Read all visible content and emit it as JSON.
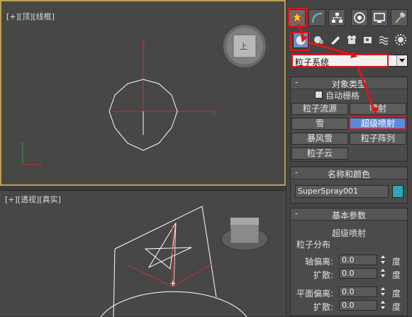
{
  "viewport_top": {
    "label": "[+][顶][线框]"
  },
  "viewport_persp": {
    "label": "[+][透视][真实]"
  },
  "viewcube": {
    "face_label": "上"
  },
  "panel": {
    "dropdown_value": "粒子系统",
    "object_type": {
      "title": "对象类型",
      "autogrid_label": "自动栅格",
      "buttons": [
        "粒子流源",
        "喷射",
        "雪",
        "超级喷射",
        "暴风雪",
        "粒子阵列",
        "粒子云"
      ],
      "selected": "超级喷射"
    },
    "name_color": {
      "title": "名称和颜色",
      "name_value": "SuperSpray001",
      "swatch_color": "#2aa6bd"
    },
    "basic_params": {
      "title": "基本参数",
      "subtitle": "超级喷射",
      "group_label": "粒子分布",
      "axis_offset_label": "轴偏离:",
      "axis_offset_value": "0.0",
      "axis_spread_label": "扩散:",
      "axis_spread_value": "0.0",
      "plane_offset_label": "平面偏离:",
      "plane_offset_value": "0.0",
      "plane_spread_label": "扩散:",
      "plane_spread_value": "0.0",
      "unit": "度"
    }
  },
  "tabs": [
    "create-tab",
    "modify-tab",
    "hierarchy-tab",
    "motion-tab",
    "display-tab",
    "utilities-tab"
  ],
  "subtabs": [
    "geometry-icon",
    "shapes-icon",
    "lights-icon",
    "cameras-icon",
    "helpers-icon",
    "spacewarps-icon",
    "systems-icon"
  ],
  "accent": {
    "highlight": "#e0141e",
    "selection": "#5b8ad9",
    "viewport_border": "#c0a050"
  }
}
